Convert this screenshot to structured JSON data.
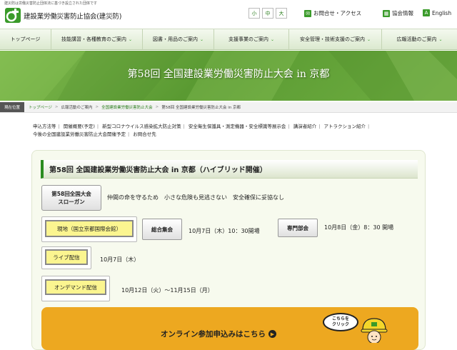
{
  "header": {
    "tagline": "建災防は労働災害防止団体法に基づき設立された団体です",
    "org_name": "建設業労働災害防止協会(建災防)",
    "size_buttons": [
      "小",
      "中",
      "大"
    ],
    "links": [
      {
        "icon": "envelope-icon",
        "label": "お問合せ・アクセス"
      },
      {
        "icon": "grid-icon",
        "label": "協会情報"
      },
      {
        "icon": "letter-a-icon",
        "label": "English"
      }
    ],
    "brand_color": "#3a9b2a"
  },
  "nav": {
    "items": [
      {
        "label": "トップページ",
        "has_dropdown": false
      },
      {
        "label": "技能講習・各種教育のご案内",
        "has_dropdown": true
      },
      {
        "label": "図書・用品のご案内",
        "has_dropdown": true
      },
      {
        "label": "支援事業のご案内",
        "has_dropdown": true
      },
      {
        "label": "安全管理・技術支援のご案内",
        "has_dropdown": true
      },
      {
        "label": "広報活動のご案内",
        "has_dropdown": true
      }
    ]
  },
  "banner": {
    "title": "第58回 全国建設業労働災害防止大会 in 京都"
  },
  "breadcrumb": {
    "label": "現在位置",
    "items": [
      {
        "label": "トップページ",
        "link": true
      },
      {
        "label": "広報活動のご案内",
        "link": false
      },
      {
        "label": "全国建設業労働災害防止大会",
        "link": true
      },
      {
        "label": "第58回 全国建設業労働災害防止大会 in 京都",
        "link": false
      }
    ]
  },
  "sublinks": {
    "row1": [
      "申込方法等",
      "開催概要(予定)",
      "新型コロナウイルス感染拡大防止対策",
      "安全衛生保護具・測定機器・安全標識等展示会",
      "講演者紹介",
      "アトラクション紹介"
    ],
    "row2": [
      "今後の全国建設業労働災害防止大会開催予定",
      "お問合せ先"
    ]
  },
  "main": {
    "title": "第58回 全国建設業労働災害防止大会 in 京都（ハイブリッド開催）",
    "slogan_label_line1": "第58回全国大会",
    "slogan_label_line2": "スローガン",
    "slogan_text": "仲間の命を守るため　小さな危険も見逃さない　安全確保に妥協なし",
    "venue_label": "現地（国立京都国際会館）",
    "general_meeting_label": "総合集会",
    "general_meeting_date": "10月7日（木）10：30開場",
    "special_meeting_label": "専門部会",
    "special_meeting_date": "10月8日（金）8：30 開場",
    "live_label": "ライブ配信",
    "live_date": "10月7日（木）",
    "ondemand_label": "オンデマンド配信",
    "ondemand_date": "10月12日（火）～11月15日（月）"
  },
  "apply": {
    "label": "オンライン参加申込みはこちら",
    "bubble_line1": "こちらを",
    "bubble_line2": "クリック",
    "color": "#eda820"
  }
}
